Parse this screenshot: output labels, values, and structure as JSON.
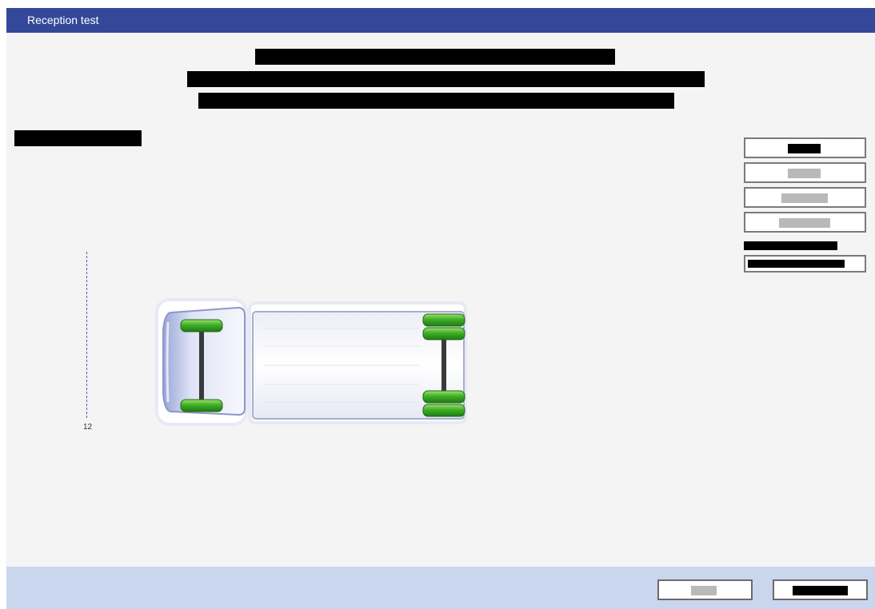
{
  "window": {
    "title": "Reception test"
  },
  "chart_data": {
    "type": "other",
    "axis_tick_label": "12"
  },
  "colors": {
    "titlebar": "#34489a",
    "footer": "#c9d6ee",
    "wheel_green": "#2e9e1e",
    "redaction": "#000000",
    "disabled_label": "#b9b9b9"
  },
  "icons": {
    "vehicle": "truck-top-view-icon"
  }
}
